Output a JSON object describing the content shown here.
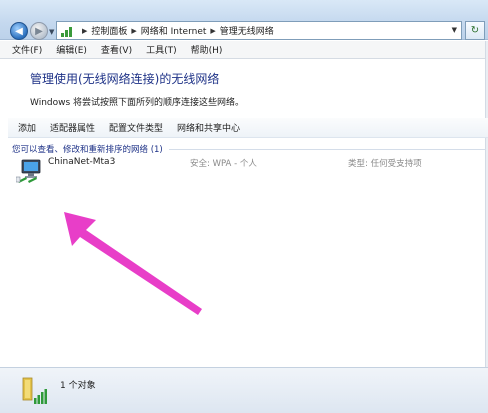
{
  "address_bar": {
    "crumbs": [
      "控制面板",
      "网络和 Internet",
      "管理无线网络"
    ],
    "back_icon": "back-arrow-icon",
    "forward_icon": "forward-arrow-icon",
    "refresh_icon": "refresh-icon",
    "refresh_glyph": "↻"
  },
  "menu": {
    "items": [
      "文件(F)",
      "编辑(E)",
      "查看(V)",
      "工具(T)",
      "帮助(H)"
    ]
  },
  "header": {
    "title": "管理使用(无线网络连接)的无线网络",
    "description": "Windows 将尝试按照下面所列的顺序连接这些网络。"
  },
  "toolbar": {
    "items": [
      "添加",
      "适配器属性",
      "配置文件类型",
      "网络和共享中心"
    ]
  },
  "networks": {
    "group_label": "您可以查看、修改和重新排序的网络 (1)",
    "items": [
      {
        "name": "ChinaNet-Mta3",
        "security": "安全: WPA - 个人",
        "type": "类型: 任何受支持项",
        "icon": "wireless-network-icon"
      }
    ]
  },
  "status": {
    "text": "1 个对象",
    "icon": "wireless-signal-icon"
  },
  "colors": {
    "title_blue": "#1e3287",
    "annotation_arrow": "#e83ec8",
    "signal_green": "#3a9a3a"
  }
}
